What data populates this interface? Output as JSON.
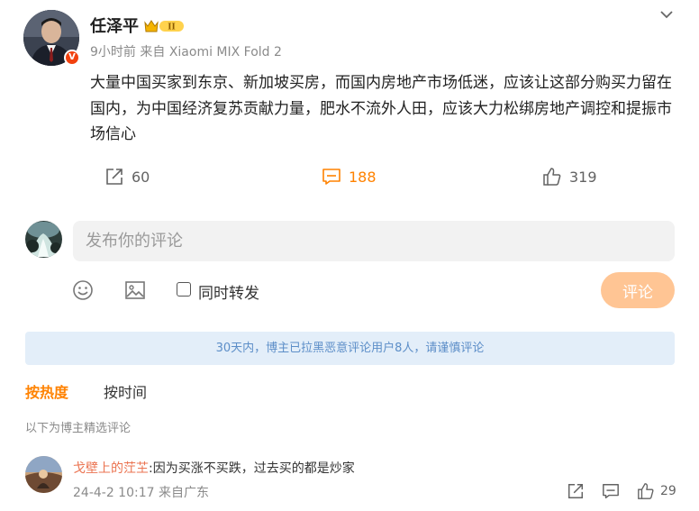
{
  "post": {
    "author": "任泽平",
    "time": "9小时前",
    "source": "来自 Xiaomi MIX Fold 2",
    "verified_badge": "V",
    "member_badge": "II",
    "content": "大量中国买家到东京、新加坡买房，而国内房地产市场低迷，应该让这部分购买力留在国内，为中国经济复苏贡献力量，肥水不流外人田，应该大力松绑房地产调控和提振市场信心",
    "reposts": "60",
    "comments": "188",
    "likes": "319"
  },
  "composer": {
    "placeholder": "发布你的评论",
    "repost_label": "同时转发",
    "submit_label": "评论"
  },
  "notice": "30天内，博主已拉黑恶意评论用户8人，请谨慎评论",
  "sort_tabs": {
    "hot": "按热度",
    "time": "按时间"
  },
  "featured_note": "以下为博主精选评论",
  "comments_list": [
    {
      "user": "戈壁上的茳芏",
      "text": ":因为买涨不买跌，过去买的都是炒家",
      "meta": "24-4-2 10:17 来自广东",
      "likes": "29"
    }
  ],
  "colors": {
    "accent": "#ff8200",
    "submit_disabled": "#ffc594",
    "notice_bg": "#e3eef9",
    "notice_text": "#5c8ec8",
    "username": "#eb7350"
  }
}
